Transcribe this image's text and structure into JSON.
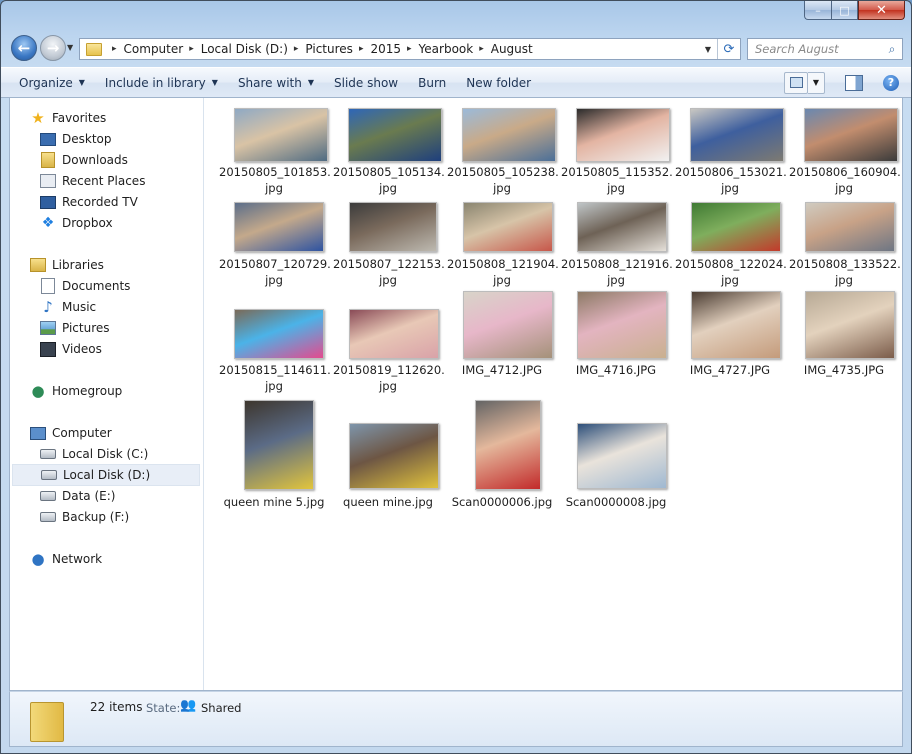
{
  "window": {
    "controls": {
      "minimize": "–",
      "maximize": "□",
      "close": "✕"
    }
  },
  "nav": {
    "back_icon": "←",
    "forward_icon": "→",
    "history_dropdown": "▼"
  },
  "address": {
    "breadcrumbs": [
      "Computer",
      "Local Disk (D:)",
      "Pictures",
      "2015",
      "Yearbook",
      "August"
    ],
    "separator": "▸",
    "dropdown": "▼",
    "refresh_icon": "⟳"
  },
  "search": {
    "placeholder": "Search August",
    "icon": "⌕"
  },
  "toolbar": {
    "organize": "Organize",
    "include_in_library": "Include in library",
    "share_with": "Share with",
    "slide_show": "Slide show",
    "burn": "Burn",
    "new_folder": "New folder",
    "dropdown_arrow": "▼",
    "view_dropdown": "▼",
    "help": "?"
  },
  "navpane": {
    "favorites": {
      "label": "Favorites",
      "items": [
        "Desktop",
        "Downloads",
        "Recent Places",
        "Recorded TV",
        "Dropbox"
      ]
    },
    "libraries": {
      "label": "Libraries",
      "items": [
        "Documents",
        "Music",
        "Pictures",
        "Videos"
      ]
    },
    "homegroup": {
      "label": "Homegroup"
    },
    "computer": {
      "label": "Computer",
      "items": [
        "Local Disk (C:)",
        "Local Disk (D:)",
        "Data (E:)",
        "Backup (F:)"
      ],
      "selected": "Local Disk (D:)"
    },
    "network": {
      "label": "Network"
    },
    "icons": {
      "star": "★",
      "dropbox": "❖",
      "music": "♪",
      "homegroup": "●",
      "network": "●"
    }
  },
  "files": [
    {
      "name": "20150805_101853.",
      "ext": "jpg",
      "colors": [
        "#8fa9c4",
        "#4f6b82",
        "#d9c3a5"
      ]
    },
    {
      "name": "20150805_105134.",
      "ext": "jpg",
      "colors": [
        "#2e66b8",
        "#1e3f7d",
        "#6a7b4f"
      ]
    },
    {
      "name": "20150805_105238.",
      "ext": "jpg",
      "colors": [
        "#9bbad9",
        "#4b6f98",
        "#c9aa88"
      ]
    },
    {
      "name": "20150805_115352.",
      "ext": "jpg",
      "colors": [
        "#2b2b2b",
        "#f1f1f1",
        "#e3b4a2"
      ]
    },
    {
      "name": "20150806_153021.",
      "ext": "jpg",
      "colors": [
        "#c9c7c2",
        "#7d7a72",
        "#3e5f9e"
      ]
    },
    {
      "name": "20150806_160904.",
      "ext": "jpg",
      "colors": [
        "#6a88b0",
        "#3b3b3b",
        "#c28d6e"
      ]
    },
    {
      "name": "20150807_120729.",
      "ext": "jpg",
      "colors": [
        "#5c6e8a",
        "#2e53a1",
        "#c4a98b"
      ]
    },
    {
      "name": "20150807_122153.",
      "ext": "jpg",
      "colors": [
        "#3c3c3c",
        "#bdb9b0",
        "#7a6a5c"
      ]
    },
    {
      "name": "20150808_121904.",
      "ext": "jpg",
      "colors": [
        "#8a8570",
        "#c7574a",
        "#d7c4a8"
      ]
    },
    {
      "name": "20150808_121916.",
      "ext": "jpg",
      "colors": [
        "#bfc5c7",
        "#e5e0d9",
        "#6e6256"
      ]
    },
    {
      "name": "20150808_122024.",
      "ext": "jpg",
      "colors": [
        "#3f7a33",
        "#c33a2b",
        "#7fae5d"
      ]
    },
    {
      "name": "20150808_133522.",
      "ext": "jpg",
      "colors": [
        "#d0cbc0",
        "#6e7684",
        "#c8a287"
      ]
    },
    {
      "name": "20150815_114611.",
      "ext": "jpg",
      "colors": [
        "#7a6a58",
        "#e44b8e",
        "#4bb3e8"
      ]
    },
    {
      "name": "20150819_112620.",
      "ext": "jpg",
      "colors": [
        "#8a4b57",
        "#d9a2a8",
        "#e8c8b6"
      ]
    },
    {
      "name": "IMG_4712.JPG",
      "ext": "",
      "colors": [
        "#d8d4c9",
        "#a49179",
        "#e7b7c9"
      ]
    },
    {
      "name": "IMG_4716.JPG",
      "ext": "",
      "colors": [
        "#8d7a66",
        "#c9b08f",
        "#e3b4c0"
      ]
    },
    {
      "name": "IMG_4727.JPG",
      "ext": "",
      "colors": [
        "#4b3d33",
        "#c49b7b",
        "#e2d0be"
      ]
    },
    {
      "name": "IMG_4735.JPG",
      "ext": "",
      "colors": [
        "#b7a995",
        "#7b5c4a",
        "#e3d2bd"
      ]
    },
    {
      "name": "queen mine 5.jpg",
      "ext": "",
      "colors": [
        "#3d362e",
        "#e2c53c",
        "#5b6b86"
      ]
    },
    {
      "name": "queen mine.jpg",
      "ext": "",
      "colors": [
        "#7e95ab",
        "#e0c23d",
        "#6d5644"
      ]
    },
    {
      "name": "Scan0000006.jpg",
      "ext": "",
      "colors": [
        "#646464",
        "#c22a2a",
        "#e4b89c"
      ]
    },
    {
      "name": "Scan0000008.jpg",
      "ext": "",
      "colors": [
        "#2d4f7a",
        "#9fb8d1",
        "#e9e3db"
      ]
    }
  ],
  "status": {
    "count": "22 items",
    "state_label": "State:",
    "state_value": "Shared"
  }
}
